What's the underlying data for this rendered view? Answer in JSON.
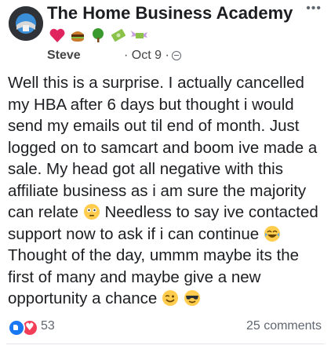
{
  "post": {
    "group_name": "The Home Business Academy",
    "author": "Steve",
    "date": "· Oct 9 ·",
    "more_icon": "•••",
    "title_emojis": [
      "heart-icon",
      "hamburger-icon",
      "tree-icon",
      "money-icon",
      "money-wings-icon"
    ],
    "body": {
      "p1": "Well this is a surprise. I actually cancelled my HBA after 6 days but thought i would send my emails out til end of month. Just logged on to samcart and boom ive made a sale. My head got all negative with this affiliate business as i am sure the majority can relate",
      "p2": " Needless to say ive contacted support now to ask if i can continue",
      "p3": " Thought of the day, ummm maybe its the first of many and maybe give a new opportunity a chance"
    }
  },
  "footer": {
    "reaction_count": "53",
    "comments": "25 comments"
  },
  "colors": {
    "like": "#1877f2",
    "love": "#f33e58",
    "text": "#1c1e21",
    "muted": "#606770"
  }
}
